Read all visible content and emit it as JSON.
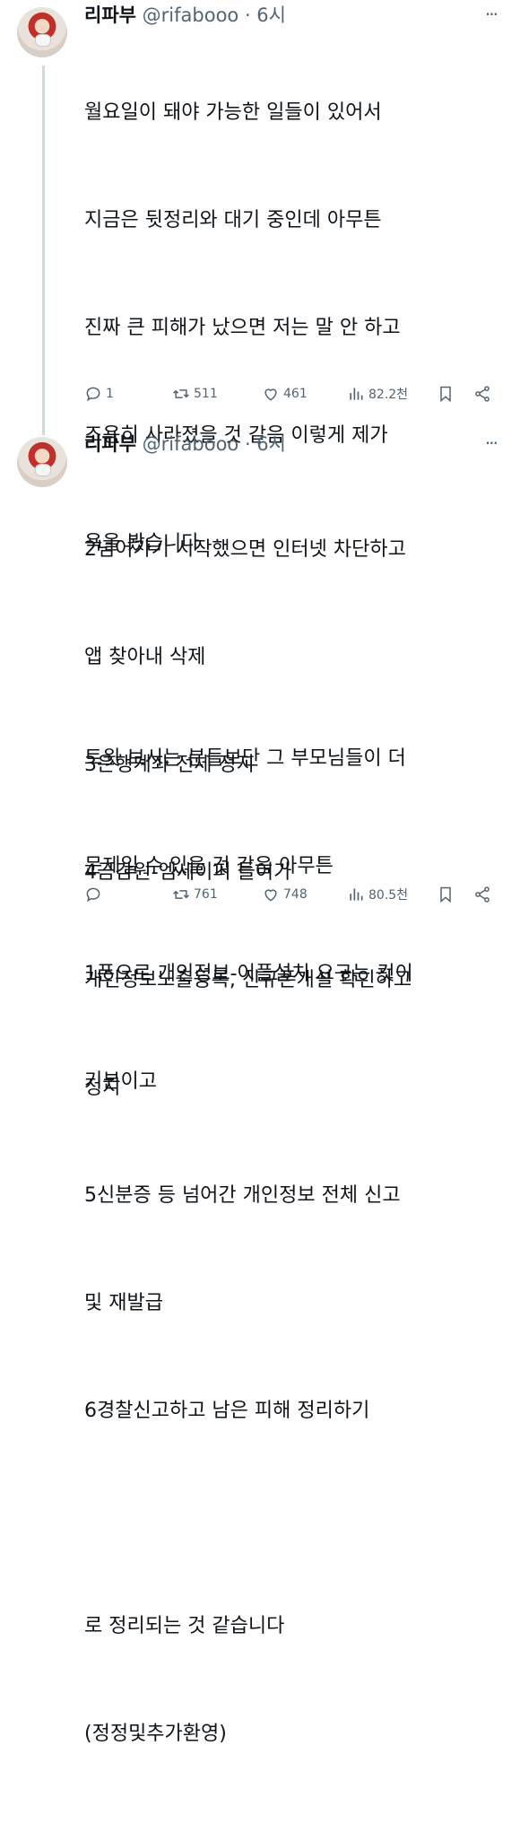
{
  "tweets": [
    {
      "name": "리파부",
      "handle": "@rifabooo",
      "time": "· 6시",
      "lines": [
        "월요일이 돼야 가능한 일들이 있어서",
        "지금은 뒷정리와 대기 중인데 아무튼",
        "진짜 큰 피해가 났으면 저는 말 안 하고",
        "조용히 사라졌을 것 같음 이렇게 제가",
        "욕을 봤습니다",
        "",
        "트윗 보시는 분들보단 그 부모님들이 더",
        "문제일 수 있을 것 같음 아무튼",
        "1폰으로 개인정보-어플설치 요구는 컷이",
        "기본이고"
      ],
      "replies": "1",
      "retweets": "511",
      "likes": "461",
      "views": "82.2천"
    },
    {
      "name": "리파부",
      "handle": "@rifabooo",
      "time": "· 6시",
      "lines": [
        "2넘어가기 시작했으면 인터넷 차단하고",
        "앱 찾아내 삭제",
        "3은행계좌 전체 정지",
        "4금감원-엠세이퍼 들어가",
        "개인정보노출등록, 신규폰개설 확인하고",
        "정지",
        "5신분증 등 넘어간 개인정보 전체 신고",
        "및 재발급",
        "6경찰신고하고 남은 피해 정리하기",
        "",
        "로 정리되는 것 같습니다",
        "(정정및추가환영)"
      ],
      "replies": "",
      "retweets": "761",
      "likes": "748",
      "views": "80.5천"
    }
  ],
  "icons": {
    "more": "more-horizontal-icon",
    "reply": "reply-icon",
    "retweet": "retweet-icon",
    "like": "heart-icon",
    "views": "views-bar-chart-icon",
    "bookmark": "bookmark-icon",
    "share": "share-icon"
  }
}
